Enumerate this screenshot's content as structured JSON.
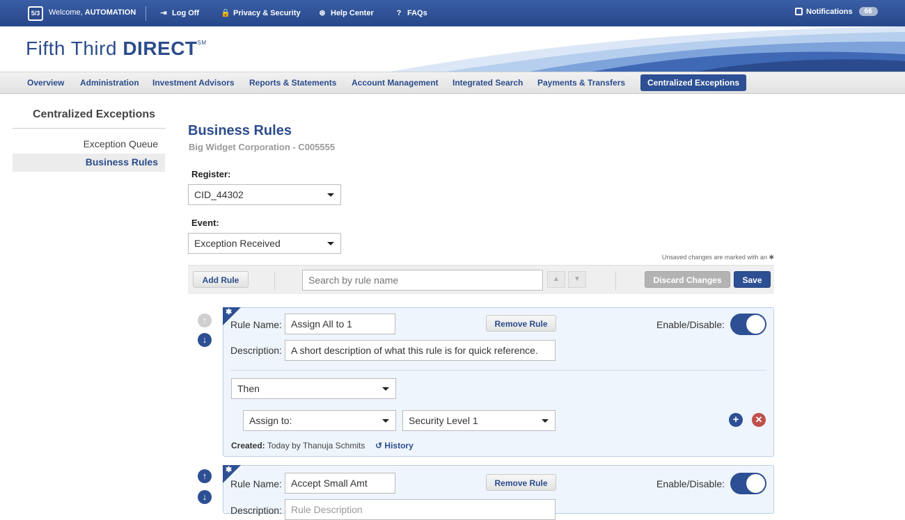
{
  "topbar": {
    "logo_text": "5/3",
    "welcome_prefix": "Welcome, ",
    "user": "AUTOMATION",
    "log_off": "Log Off",
    "privacy": "Privacy & Security",
    "help": "Help Center",
    "faqs": "FAQs",
    "notifications": "Notifications",
    "notification_count": "66"
  },
  "brand": {
    "name_light": "Fifth Third ",
    "name_bold": "DIRECT",
    "mark": "SM"
  },
  "nav": {
    "items": [
      "Overview",
      "Administration",
      "Investment Advisors",
      "Reports & Statements",
      "Account Management",
      "Integrated Search",
      "Payments & Transfers",
      "Centralized Exceptions"
    ],
    "active": "Centralized Exceptions"
  },
  "sidebar": {
    "title": "Centralized Exceptions",
    "items": [
      "Exception Queue",
      "Business Rules"
    ],
    "active": "Business Rules"
  },
  "main": {
    "title": "Business Rules",
    "subtitle": "Big Widget Corporation - C005555",
    "register_label": "Register:",
    "register_value": "CID_44302",
    "event_label": "Event:",
    "event_value": "Exception Received",
    "unsaved_note": "Unsaved changes are marked with an ✱"
  },
  "toolbar": {
    "add_rule": "Add Rule",
    "search_placeholder": "Search by rule name",
    "discard": "Discard Changes",
    "save": "Save"
  },
  "rules": [
    {
      "name_label": "Rule Name:",
      "name": "Assign All to 1",
      "remove": "Remove Rule",
      "enable_label": "Enable/Disable:",
      "enabled": true,
      "desc_label": "Description:",
      "description": "A short description of what this rule is for quick reference.",
      "then": "Then",
      "action": "Assign to:",
      "target": "Security Level 1",
      "created_label": "Created:",
      "created_value": "Today by Thanuja Schmits",
      "history": "History"
    },
    {
      "name_label": "Rule Name:",
      "name": "Accept Small Amt",
      "remove": "Remove Rule",
      "enable_label": "Enable/Disable:",
      "enabled": true,
      "desc_label": "Description:",
      "description_placeholder": "Rule Description"
    }
  ],
  "colors": {
    "brand_blue": "#2d4f93",
    "remove_red": "#c0504d"
  }
}
